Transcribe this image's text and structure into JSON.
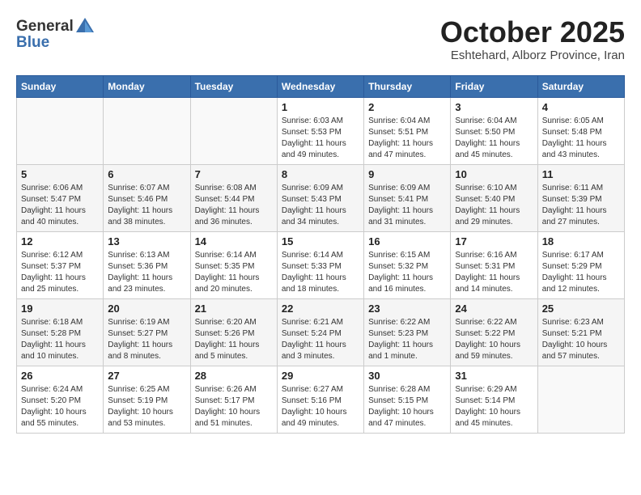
{
  "header": {
    "logo_general": "General",
    "logo_blue": "Blue",
    "month": "October 2025",
    "location": "Eshtehard, Alborz Province, Iran"
  },
  "days_of_week": [
    "Sunday",
    "Monday",
    "Tuesday",
    "Wednesday",
    "Thursday",
    "Friday",
    "Saturday"
  ],
  "weeks": [
    [
      {
        "day": "",
        "info": ""
      },
      {
        "day": "",
        "info": ""
      },
      {
        "day": "",
        "info": ""
      },
      {
        "day": "1",
        "info": "Sunrise: 6:03 AM\nSunset: 5:53 PM\nDaylight: 11 hours and 49 minutes."
      },
      {
        "day": "2",
        "info": "Sunrise: 6:04 AM\nSunset: 5:51 PM\nDaylight: 11 hours and 47 minutes."
      },
      {
        "day": "3",
        "info": "Sunrise: 6:04 AM\nSunset: 5:50 PM\nDaylight: 11 hours and 45 minutes."
      },
      {
        "day": "4",
        "info": "Sunrise: 6:05 AM\nSunset: 5:48 PM\nDaylight: 11 hours and 43 minutes."
      }
    ],
    [
      {
        "day": "5",
        "info": "Sunrise: 6:06 AM\nSunset: 5:47 PM\nDaylight: 11 hours and 40 minutes."
      },
      {
        "day": "6",
        "info": "Sunrise: 6:07 AM\nSunset: 5:46 PM\nDaylight: 11 hours and 38 minutes."
      },
      {
        "day": "7",
        "info": "Sunrise: 6:08 AM\nSunset: 5:44 PM\nDaylight: 11 hours and 36 minutes."
      },
      {
        "day": "8",
        "info": "Sunrise: 6:09 AM\nSunset: 5:43 PM\nDaylight: 11 hours and 34 minutes."
      },
      {
        "day": "9",
        "info": "Sunrise: 6:09 AM\nSunset: 5:41 PM\nDaylight: 11 hours and 31 minutes."
      },
      {
        "day": "10",
        "info": "Sunrise: 6:10 AM\nSunset: 5:40 PM\nDaylight: 11 hours and 29 minutes."
      },
      {
        "day": "11",
        "info": "Sunrise: 6:11 AM\nSunset: 5:39 PM\nDaylight: 11 hours and 27 minutes."
      }
    ],
    [
      {
        "day": "12",
        "info": "Sunrise: 6:12 AM\nSunset: 5:37 PM\nDaylight: 11 hours and 25 minutes."
      },
      {
        "day": "13",
        "info": "Sunrise: 6:13 AM\nSunset: 5:36 PM\nDaylight: 11 hours and 23 minutes."
      },
      {
        "day": "14",
        "info": "Sunrise: 6:14 AM\nSunset: 5:35 PM\nDaylight: 11 hours and 20 minutes."
      },
      {
        "day": "15",
        "info": "Sunrise: 6:14 AM\nSunset: 5:33 PM\nDaylight: 11 hours and 18 minutes."
      },
      {
        "day": "16",
        "info": "Sunrise: 6:15 AM\nSunset: 5:32 PM\nDaylight: 11 hours and 16 minutes."
      },
      {
        "day": "17",
        "info": "Sunrise: 6:16 AM\nSunset: 5:31 PM\nDaylight: 11 hours and 14 minutes."
      },
      {
        "day": "18",
        "info": "Sunrise: 6:17 AM\nSunset: 5:29 PM\nDaylight: 11 hours and 12 minutes."
      }
    ],
    [
      {
        "day": "19",
        "info": "Sunrise: 6:18 AM\nSunset: 5:28 PM\nDaylight: 11 hours and 10 minutes."
      },
      {
        "day": "20",
        "info": "Sunrise: 6:19 AM\nSunset: 5:27 PM\nDaylight: 11 hours and 8 minutes."
      },
      {
        "day": "21",
        "info": "Sunrise: 6:20 AM\nSunset: 5:26 PM\nDaylight: 11 hours and 5 minutes."
      },
      {
        "day": "22",
        "info": "Sunrise: 6:21 AM\nSunset: 5:24 PM\nDaylight: 11 hours and 3 minutes."
      },
      {
        "day": "23",
        "info": "Sunrise: 6:22 AM\nSunset: 5:23 PM\nDaylight: 11 hours and 1 minute."
      },
      {
        "day": "24",
        "info": "Sunrise: 6:22 AM\nSunset: 5:22 PM\nDaylight: 10 hours and 59 minutes."
      },
      {
        "day": "25",
        "info": "Sunrise: 6:23 AM\nSunset: 5:21 PM\nDaylight: 10 hours and 57 minutes."
      }
    ],
    [
      {
        "day": "26",
        "info": "Sunrise: 6:24 AM\nSunset: 5:20 PM\nDaylight: 10 hours and 55 minutes."
      },
      {
        "day": "27",
        "info": "Sunrise: 6:25 AM\nSunset: 5:19 PM\nDaylight: 10 hours and 53 minutes."
      },
      {
        "day": "28",
        "info": "Sunrise: 6:26 AM\nSunset: 5:17 PM\nDaylight: 10 hours and 51 minutes."
      },
      {
        "day": "29",
        "info": "Sunrise: 6:27 AM\nSunset: 5:16 PM\nDaylight: 10 hours and 49 minutes."
      },
      {
        "day": "30",
        "info": "Sunrise: 6:28 AM\nSunset: 5:15 PM\nDaylight: 10 hours and 47 minutes."
      },
      {
        "day": "31",
        "info": "Sunrise: 6:29 AM\nSunset: 5:14 PM\nDaylight: 10 hours and 45 minutes."
      },
      {
        "day": "",
        "info": ""
      }
    ]
  ]
}
